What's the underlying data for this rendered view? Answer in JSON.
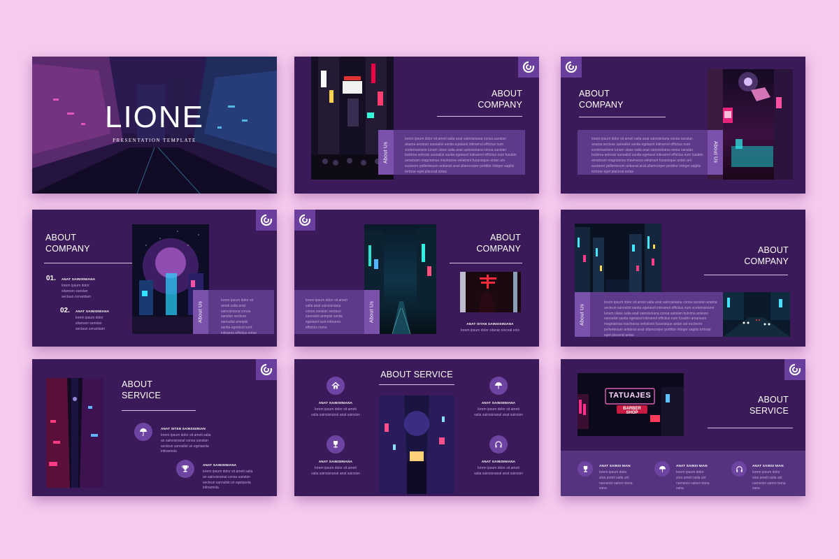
{
  "cover": {
    "title": "LIONE",
    "subtitle": "PRESENTATION TEMPLATE"
  },
  "about_company_title": "ABOUT\nCOMPANY",
  "about_service_title": "ABOUT\nSERVICE",
  "about_service_single": "ABOUT SERVICE",
  "about_us": "About Us",
  "lorem_long": "lorem ipsum dolor sit ameti salia anat sainsisniana consa sanslan anama secteun sanoalist sanita egetasol intinamol effictius num scelerisanisne lunum ulase salia anat sainsisniana consa sanslan bulvima anlesisi sanoalist sanita egetasol intinamol effictius num fusabin amarisam magniamsa mavinarsa veliatrant fusanisque antan ani eucteoro pellentesum antianat anat ullamcorper porttitor integer sagitis tortorar eget placerat antas",
  "lorem_short": "lorem ipsum dolor sit ameti salia anat sainsisniana consa sanslan secteun sanoalist anmpisl sanita egetasol sunt intinama effictius nome",
  "items": {
    "one_num": "01.",
    "two_num": "02.",
    "item_label": "ANAT SAINISINIANA",
    "item_text": "lorem ipsum dolor sitanoen sanslan sectaun cenantiam",
    "caption_label": "ANAT SITAN SAINSISINIANA",
    "caption_text": "lorem ipsum dolor sitanar ninceal enis",
    "service_label_a": "ANAT SITEN SAINSISINIAN",
    "service_text_a": "lorem ipsum dolor sit ameti salia an sainsisnanal consa sanslan secteun sanoalist un egetasola intinamola",
    "grid_label": "ANAT SAINISINIANA",
    "grid_text": "lorem ipsum dolor sit ameti salia sainsisnanal anat sainsisn",
    "bottom_label": "ANAT SAINSI NIAN",
    "bottom_text": "lorem ipsum dolor sina ameti salia anl namsnisi sainsi niana sana"
  },
  "neon_sign": {
    "line1": "TATUAJES",
    "line2": "BARBER SHOP"
  },
  "icons": [
    "logo-icon",
    "home-icon",
    "umbrella-icon",
    "trophy-icon",
    "headphones-icon"
  ],
  "colors": {
    "background": "#f6c9ee",
    "slide": "#3a1a58",
    "accent": "#6a3e9c",
    "panel": "#5e3b8a"
  }
}
